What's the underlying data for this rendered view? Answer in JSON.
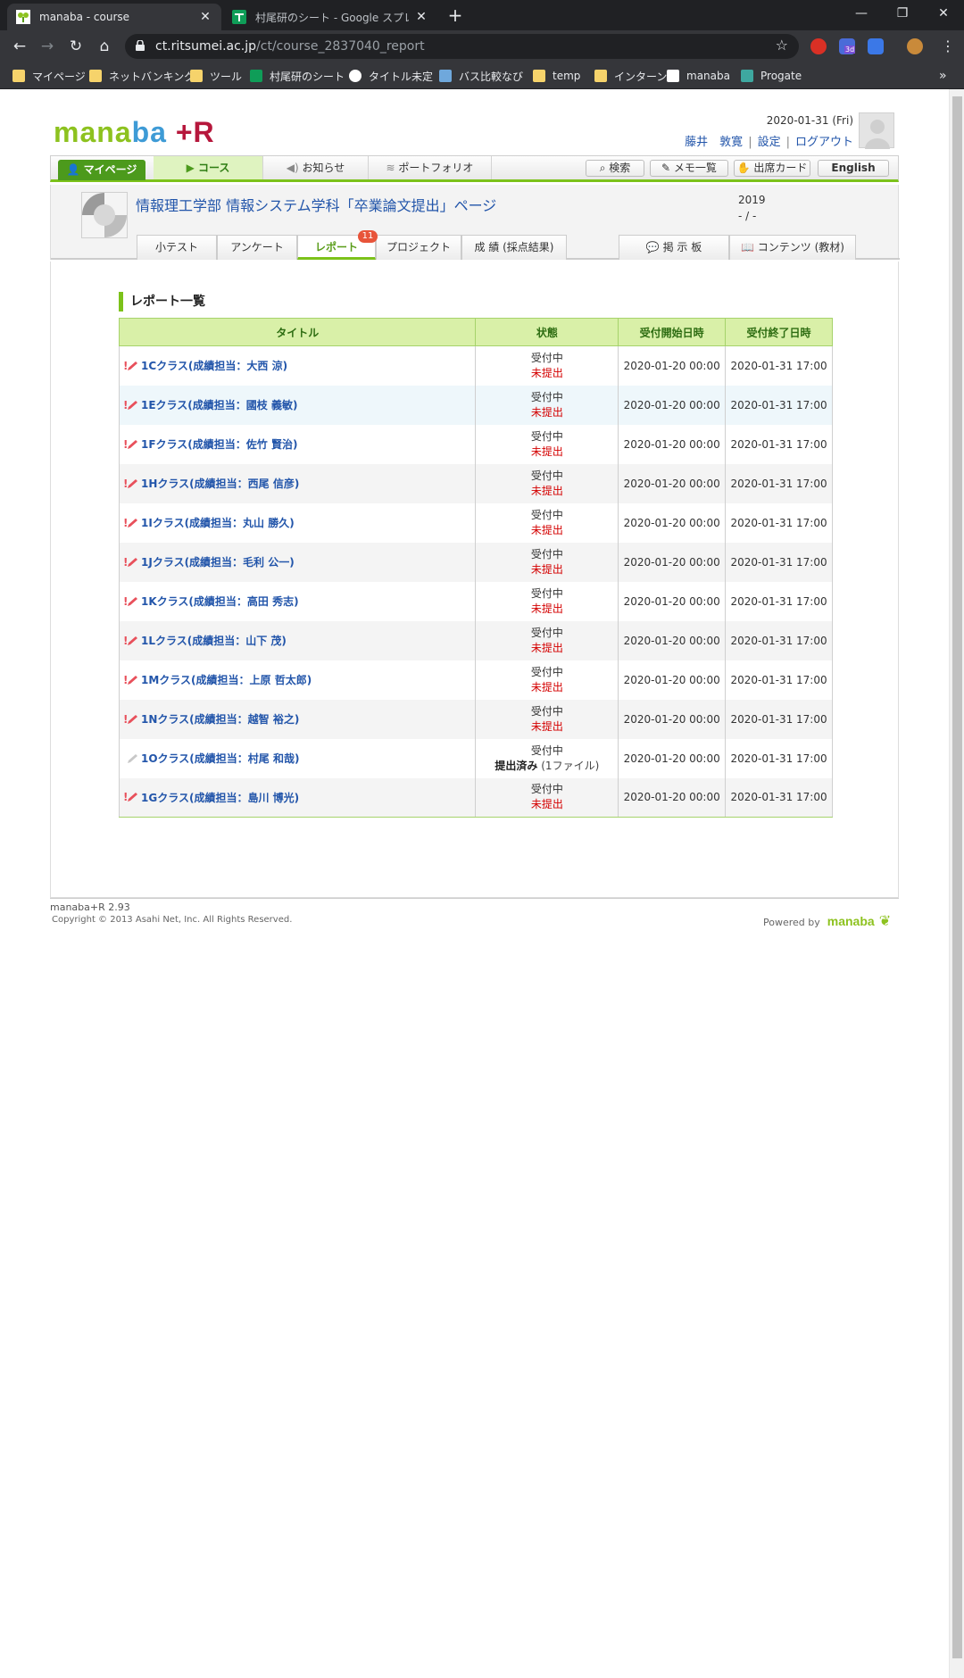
{
  "browser": {
    "tabs": [
      {
        "title": "manaba - course",
        "active": true
      },
      {
        "title": "村尾研のシート - Google スプレッドシ",
        "active": false
      }
    ],
    "url_host": "ct.ritsumei.ac.jp",
    "url_path": "/ct/course_2837040_report",
    "bookmarks": [
      {
        "label": "マイページ",
        "icon": "folder-icon"
      },
      {
        "label": "ネットバンキング",
        "icon": "folder-icon"
      },
      {
        "label": "ツール",
        "icon": "folder-icon"
      },
      {
        "label": "村尾研のシート",
        "icon": "sheets-icon"
      },
      {
        "label": "タイトル未定",
        "icon": "notion-icon"
      },
      {
        "label": "バス比較なび",
        "icon": "bus-icon"
      },
      {
        "label": "temp",
        "icon": "folder-icon"
      },
      {
        "label": "インターン",
        "icon": "folder-icon"
      },
      {
        "label": "manaba",
        "icon": "manaba-icon"
      },
      {
        "label": "Progate",
        "icon": "progate-icon"
      }
    ],
    "extension_badge": "3d"
  },
  "header": {
    "logo": {
      "part1": "mana",
      "part2": "ba",
      "part3": "+R"
    },
    "date": "2020-01-31 (Fri)",
    "user_name": "藤井　敦寛",
    "settings_label": "設定",
    "logout_label": "ログアウト"
  },
  "global_nav": {
    "mypage": "マイページ",
    "course": "コース",
    "notice": "お知らせ",
    "portfolio": "ポートフォリオ",
    "search": "検索",
    "memo": "メモ一覧",
    "attendance": "出席カード",
    "english": "English"
  },
  "course": {
    "title": "情報理工学部 情報システム学科「卒業論文提出」ページ",
    "year": "2019",
    "period": "- / -",
    "tabs": [
      "小テスト",
      "アンケート",
      "レポート",
      "プロジェクト",
      "成 績 (採点結果)"
    ],
    "active_tab": "レポート",
    "report_badge": "11",
    "right_tabs": [
      "掲 示 板",
      "コンテンツ (教材)"
    ]
  },
  "report_list": {
    "heading": "レポート一覧",
    "columns": [
      "タイトル",
      "状態",
      "受付開始日時",
      "受付終了日時"
    ],
    "rows": [
      {
        "title": "1Cクラス(成績担当：大西 涼)",
        "status": "受付中",
        "submit": "未提出",
        "start": "2020-01-20 00:00",
        "end": "2020-01-31 17:00"
      },
      {
        "title": "1Eクラス(成績担当：國枝 義敏)",
        "status": "受付中",
        "submit": "未提出",
        "start": "2020-01-20 00:00",
        "end": "2020-01-31 17:00"
      },
      {
        "title": "1Fクラス(成績担当：佐竹 賢治)",
        "status": "受付中",
        "submit": "未提出",
        "start": "2020-01-20 00:00",
        "end": "2020-01-31 17:00"
      },
      {
        "title": "1Hクラス(成績担当：西尾 信彦)",
        "status": "受付中",
        "submit": "未提出",
        "start": "2020-01-20 00:00",
        "end": "2020-01-31 17:00"
      },
      {
        "title": "1Iクラス(成績担当：丸山 勝久)",
        "status": "受付中",
        "submit": "未提出",
        "start": "2020-01-20 00:00",
        "end": "2020-01-31 17:00"
      },
      {
        "title": "1Jクラス(成績担当：毛利 公一)",
        "status": "受付中",
        "submit": "未提出",
        "start": "2020-01-20 00:00",
        "end": "2020-01-31 17:00"
      },
      {
        "title": "1Kクラス(成績担当：高田 秀志)",
        "status": "受付中",
        "submit": "未提出",
        "start": "2020-01-20 00:00",
        "end": "2020-01-31 17:00"
      },
      {
        "title": "1Lクラス(成績担当：山下 茂)",
        "status": "受付中",
        "submit": "未提出",
        "start": "2020-01-20 00:00",
        "end": "2020-01-31 17:00"
      },
      {
        "title": "1Mクラス(成績担当：上原 哲太郎)",
        "status": "受付中",
        "submit": "未提出",
        "start": "2020-01-20 00:00",
        "end": "2020-01-31 17:00"
      },
      {
        "title": "1Nクラス(成績担当：越智 裕之)",
        "status": "受付中",
        "submit": "未提出",
        "start": "2020-01-20 00:00",
        "end": "2020-01-31 17:00"
      },
      {
        "title": "1Oクラス(成績担当：村尾 和哉)",
        "status": "受付中",
        "submit": "提出済み",
        "submit_sub": " (1ファイル)",
        "submitted": true,
        "start": "2020-01-20 00:00",
        "end": "2020-01-31 17:00"
      },
      {
        "title": "1Gクラス(成績担当：島川 博光)",
        "status": "受付中",
        "submit": "未提出",
        "start": "2020-01-20 00:00",
        "end": "2020-01-31 17:00"
      }
    ]
  },
  "footer": {
    "version": "manaba+R 2.93",
    "copyright": "Copyright © 2013 Asahi Net, Inc. All Rights Reserved.",
    "powered_by": "Powered by",
    "powered_logo": "manaba"
  },
  "colors": {
    "accent": "#7cc21a",
    "link": "#2255aa",
    "unsubmitted": "#d40000",
    "header_bg": "#d9f0a8"
  }
}
